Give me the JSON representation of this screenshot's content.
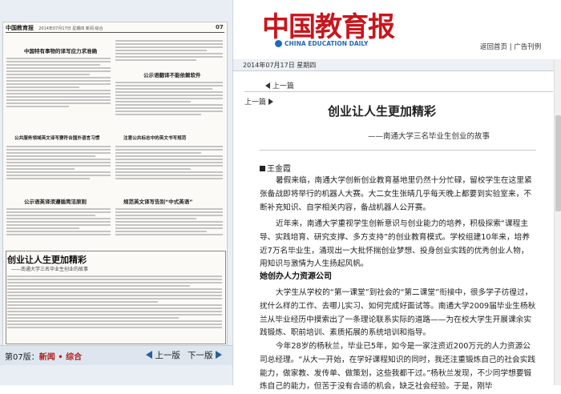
{
  "left_panel": {
    "masthead": "中国教育报",
    "masthead_extra": "2014年07月17日 星期四 新闻·综合",
    "page_no": "07",
    "headlines": [
      "中国特有事物的译写应力求准确",
      "公示语翻译不能依赖软件",
      "公共服务领域英文译写要符合国外语言习惯",
      "注意公共标志中的英文书写规范",
      "公示语英译须遵循简洁原则",
      "规范英文译写告别“中式英语”"
    ],
    "lead_title": "创业让人生更加精彩",
    "lead_subtitle": "——南通大学三名毕业生创业的故事",
    "footer": {
      "section_prefix": "第07版：",
      "section_name": "新闻 • 综合",
      "prev_label": "上一版",
      "next_label": "下一版"
    }
  },
  "header": {
    "logo_cn": "中国教育报",
    "logo_en": "CHINA EDUCATION DAILY",
    "link_home": "返回首页",
    "link_sep": " | ",
    "link_ads": "广告刊例",
    "date": "2014年07月17日  星期四"
  },
  "article_nav": {
    "prev_article": "上一篇",
    "next_article": "上一篇"
  },
  "article": {
    "title": "创业让人生更加精彩",
    "subtitle": "——南通大学三名毕业生创业的故事",
    "author": "王金霞",
    "paragraphs": [
      "暑假来临，南通大学创新创业教育基地里仍然十分忙碌，留校学生在这里紧张备战即将举行的机器人大赛。大二女生张晴几乎每天晚上都要到实验室来，不断补充知识、自学相关内容，备战机器人公开赛。",
      "近年来，南通大学重视学生创新意识与创业能力的培养，积极探索“课程主导、实践培育、研究支撑、多方支持”的创业教育模式。学校组建10年来，培养近7万名毕业生，涌现出一大批怀揣创业梦想、投身创业实践的优秀创业人物，用知识与激情为人生扬起风帆。",
      "大学生从学校的“第一课堂”到社会的“第二课堂”衔接中，很多学子彷徨过，扰什么样的工作、去哪儿实习、如何完成好面试等。南通大学2009届毕业生杨秋兰从毕业经历中摸索出了一条理论联系实际的道路——为在校大学生开展课余实践锻炼、职前培训、素质拓展的系统培训和指导。",
      "今年28岁的杨秋兰，毕业已5年，如今是一家注资近200万元的人力资源公司总经理。“从大一开始，在学好课程知识的同时，我还注重锻炼自己的社会实践能力，做家教、发传单、做策划，这些我都干过。”杨秋兰发现，不少同学想要锻炼自己的能力，但苦于没有合适的机会，缺乏社会经验。于是，刚毕"
    ],
    "subheading": "她创办人力资源公司"
  },
  "colors": {
    "brand_red": "#c8161d",
    "brand_blue": "#1f6bb6"
  }
}
